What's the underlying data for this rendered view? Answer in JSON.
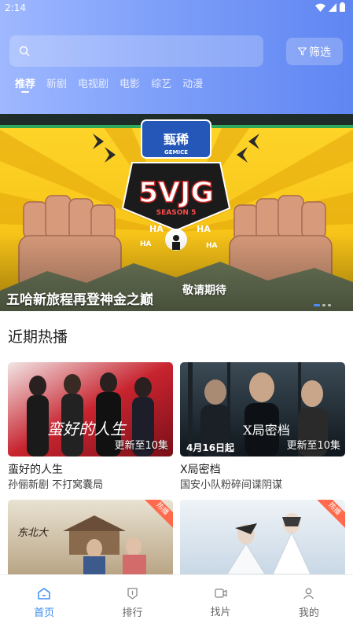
{
  "status": {
    "time": "2:14"
  },
  "search": {
    "placeholder": ""
  },
  "filter": {
    "label": "筛选",
    "icon": "filter-icon"
  },
  "tabs": [
    {
      "label": "推荐",
      "active": true
    },
    {
      "label": "新剧"
    },
    {
      "label": "电视剧"
    },
    {
      "label": "电影"
    },
    {
      "label": "综艺"
    },
    {
      "label": "动漫"
    }
  ],
  "banner": {
    "title": "五哈新旅程再登神金之巅",
    "subtitle": "敬请期待",
    "logo_top": "甄稀",
    "logo_top_en": "GEMICE",
    "logo_main": "5VJG",
    "logo_season": "SEASON 5",
    "ha": "HA"
  },
  "section": {
    "title": "近期热播"
  },
  "cards": [
    {
      "title": "蛮好的人生",
      "desc": "孙俪新剧 不打窝囊局",
      "update": "更新至10集",
      "art_text": "蛮好的人生",
      "hot": ""
    },
    {
      "title": "X局密档",
      "desc": "国安小队粉碎间谍阴谋",
      "update": "更新至10集",
      "art_text": "X局密档",
      "date_text": "4月16日起",
      "hot": ""
    },
    {
      "title": "",
      "desc": "",
      "update": "",
      "art_text": "东北大",
      "hot": "热播"
    },
    {
      "title": "",
      "desc": "",
      "update": "",
      "art_text": "",
      "hot": "热播"
    }
  ],
  "nav": [
    {
      "label": "首页",
      "icon": "home-icon",
      "active": true
    },
    {
      "label": "排行",
      "icon": "ranking-icon"
    },
    {
      "label": "找片",
      "icon": "video-icon"
    },
    {
      "label": "我的",
      "icon": "person-icon"
    }
  ],
  "colors": {
    "accent": "#3a8cf3",
    "header_start": "#9fb8ff",
    "header_end": "#5f86f2",
    "hot": "#ff6a4d"
  }
}
